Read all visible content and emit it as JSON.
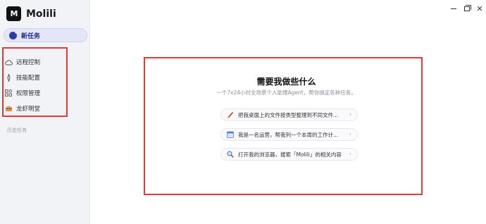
{
  "app": {
    "logo_text": "M",
    "name": "Molili"
  },
  "sidebar": {
    "new_task_label": "新任务",
    "items": [
      {
        "label": "远程控制",
        "icon": "cloud-icon"
      },
      {
        "label": "技能配置",
        "icon": "sparkle-icon"
      },
      {
        "label": "权限管理",
        "icon": "grid-icon"
      },
      {
        "label": "龙虾明堂",
        "icon": "burger-icon"
      }
    ],
    "history_label": "历史任务"
  },
  "main": {
    "title": "需要我做些什么",
    "subtitle": "一个7x24小时全场景个人助理Agent，帮你搞定各种任务。",
    "suggestions": [
      {
        "text": "把我桌面上的文件按类型整理到不同文件...",
        "icon": "brush-icon"
      },
      {
        "text": "我是一名运营，帮我列一个本周的工作计...",
        "icon": "calendar-icon"
      },
      {
        "text": "打开我的浏览器，搜索「Molili」的相关内容",
        "icon": "magnifier-icon"
      }
    ]
  }
}
